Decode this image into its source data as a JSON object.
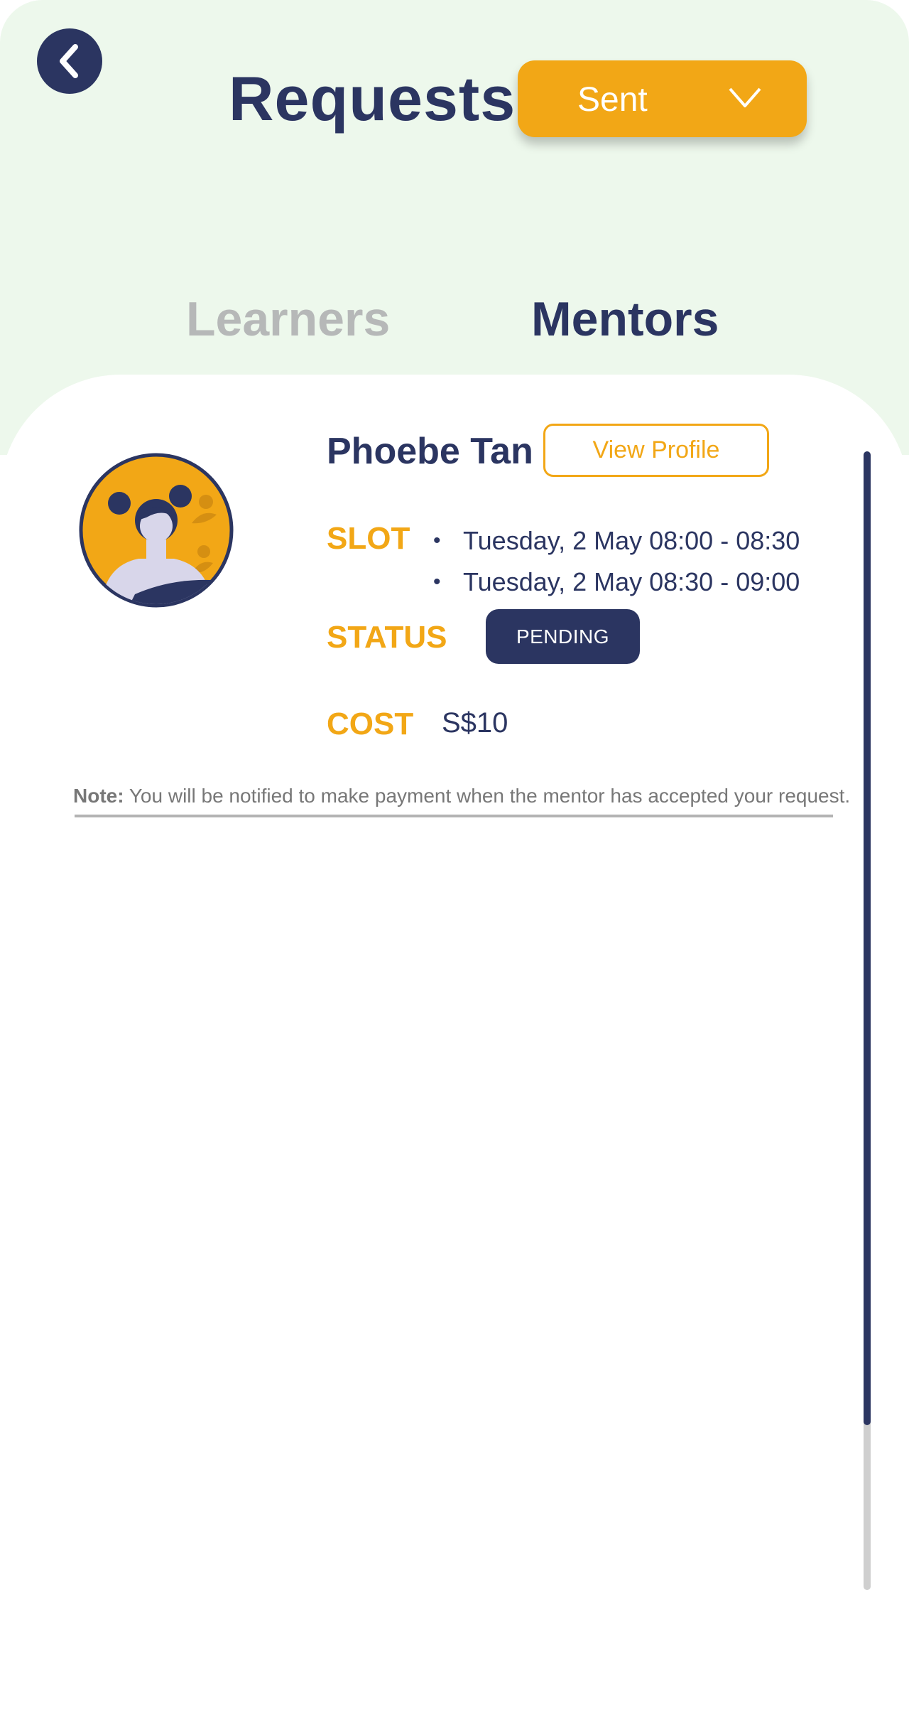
{
  "header": {
    "title": "Requests",
    "back_icon": "chevron-left-icon",
    "filter": {
      "selected": "Sent",
      "icon": "chevron-down-icon"
    }
  },
  "tabs": [
    {
      "label": "Learners",
      "active": false
    },
    {
      "label": "Mentors",
      "active": true
    }
  ],
  "request": {
    "mentor_name": "Phoebe Tan",
    "avatar_icon": "user-avatar-illustration",
    "view_profile_label": "View Profile",
    "slot_label": "SLOT",
    "slots": [
      "Tuesday, 2 May 08:00 - 08:30",
      "Tuesday, 2 May 08:30 - 09:00"
    ],
    "status_label": "STATUS",
    "status_value": "PENDING",
    "cost_label": "COST",
    "cost_value": "S$10"
  },
  "note": {
    "prefix": "Note:",
    "text": " You will be notified to make payment when the mentor has accepted your request."
  },
  "colors": {
    "primary": "#2b3561",
    "accent": "#f2a716",
    "header_bg": "#edf8ec",
    "muted": "#b6b8b8"
  }
}
